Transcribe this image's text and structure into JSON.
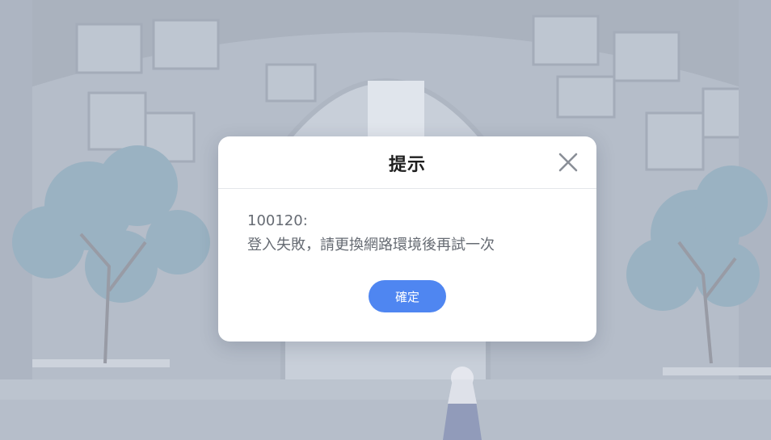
{
  "dialog": {
    "title": "提示",
    "close_icon": "close-icon",
    "error_code": "100120:",
    "message": "登入失敗，請更換網路環境後再試一次",
    "confirm_label": "確定"
  },
  "colors": {
    "accent": "#4f86f1",
    "message_text": "#666b73",
    "title_text": "#1e1e1e"
  }
}
